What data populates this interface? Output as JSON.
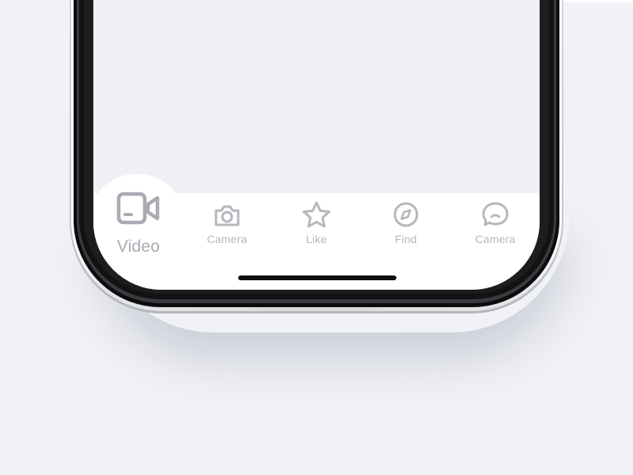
{
  "colors": {
    "background": "#f1f2f6",
    "tabbar_background": "#ffffff",
    "icon_inactive": "#b6b7be",
    "icon_active": "#a9aab2",
    "home_indicator": "#0f0f11",
    "bezel": "#0c0c0e"
  },
  "tabbar": {
    "active_index": 0,
    "tabs": [
      {
        "label": "Video",
        "icon": "video-camera-icon",
        "active": true
      },
      {
        "label": "Camera",
        "icon": "camera-icon",
        "active": false
      },
      {
        "label": "Like",
        "icon": "star-icon",
        "active": false
      },
      {
        "label": "Find",
        "icon": "compass-icon",
        "active": false
      },
      {
        "label": "Camera",
        "icon": "chat-bubble-icon",
        "active": false
      }
    ]
  }
}
